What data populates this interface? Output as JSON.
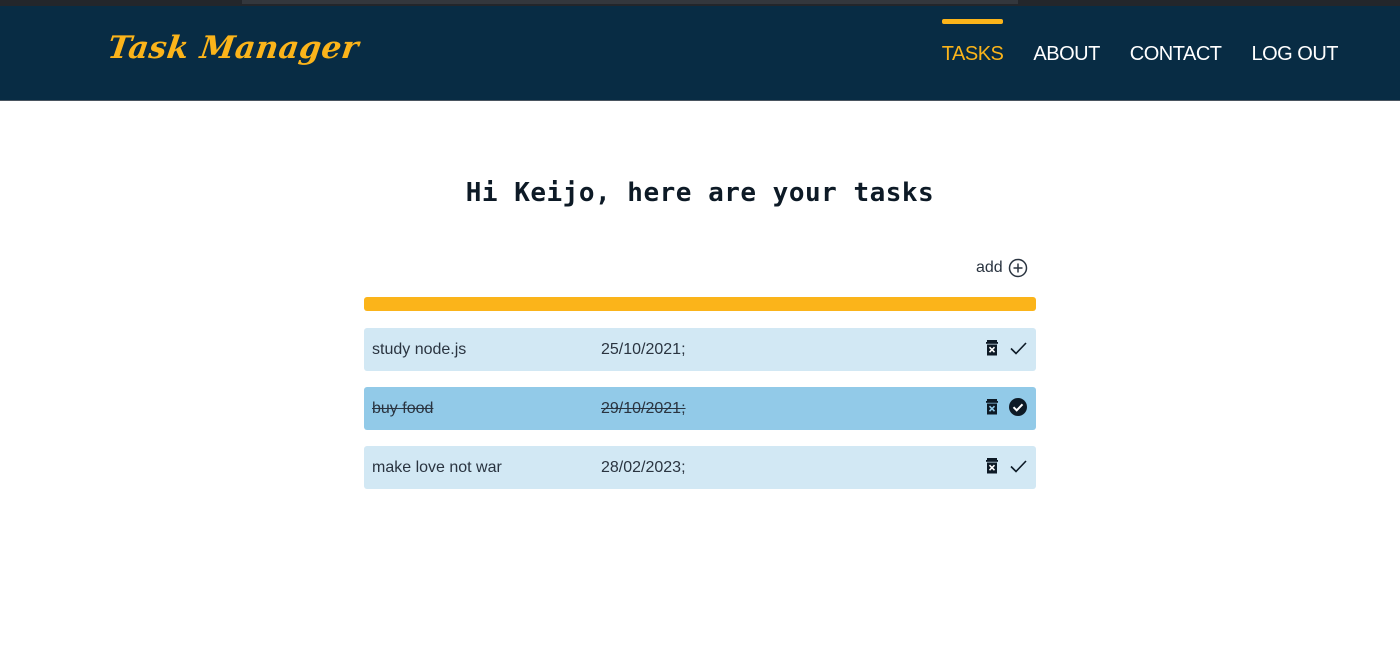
{
  "app": {
    "brand": "Task Manager"
  },
  "nav": {
    "items": [
      {
        "label": "TASKS",
        "active": true
      },
      {
        "label": "ABOUT",
        "active": false
      },
      {
        "label": "CONTACT",
        "active": false
      },
      {
        "label": "LOG OUT",
        "active": false
      }
    ]
  },
  "main": {
    "greeting": "Hi Keijo, here are your tasks",
    "add_label": "add"
  },
  "tasks": [
    {
      "name": "study node.js",
      "date": "25/10/2021;",
      "done": false
    },
    {
      "name": "buy food",
      "date": "29/10/2021;",
      "done": true
    },
    {
      "name": "make love not war",
      "date": "28/02/2023;",
      "done": false
    }
  ],
  "colors": {
    "navbar": "#082c44",
    "accent": "#fbb41a",
    "task_bg": "#d2e8f4",
    "task_done_bg": "#92cae8"
  },
  "icons": {
    "add": "plus-circle-icon",
    "delete": "trash-icon",
    "complete": "check-icon",
    "completed": "check-circle-icon"
  }
}
